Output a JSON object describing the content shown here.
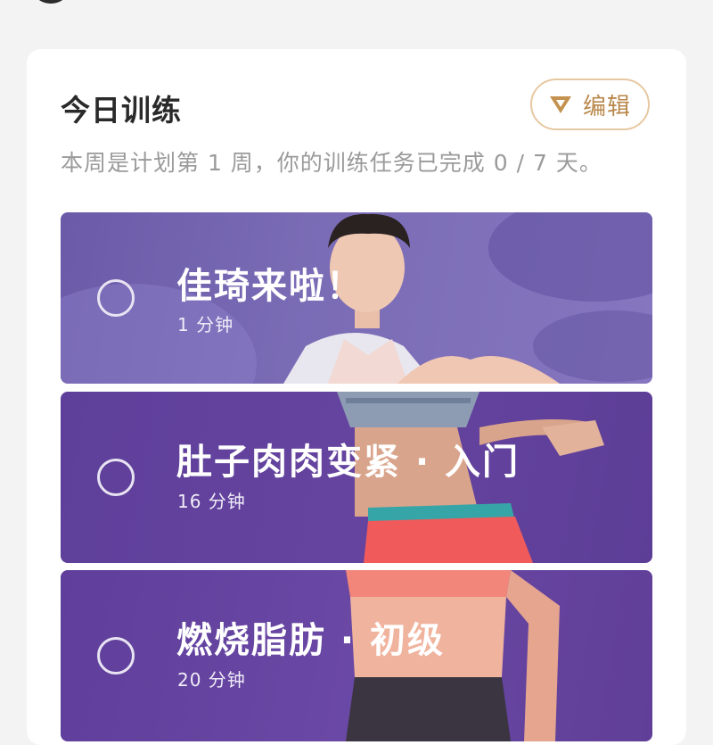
{
  "today": {
    "title": "今日训练",
    "edit_label": "编辑",
    "progress_text": "本周是计划第 1 周，你的训练任务已完成 0 / 7 天。"
  },
  "workouts": [
    {
      "name": "佳琦来啦！",
      "duration": "1 分钟",
      "completed": false
    },
    {
      "name": "肚子肉肉变紧 · 入门",
      "duration": "16 分钟",
      "completed": false
    },
    {
      "name": "燃烧脂肪 · 初级",
      "duration": "20 分钟",
      "completed": false
    }
  ],
  "colors": {
    "accent_gold": "#b9884b",
    "card_purple": "#6a48a5"
  }
}
